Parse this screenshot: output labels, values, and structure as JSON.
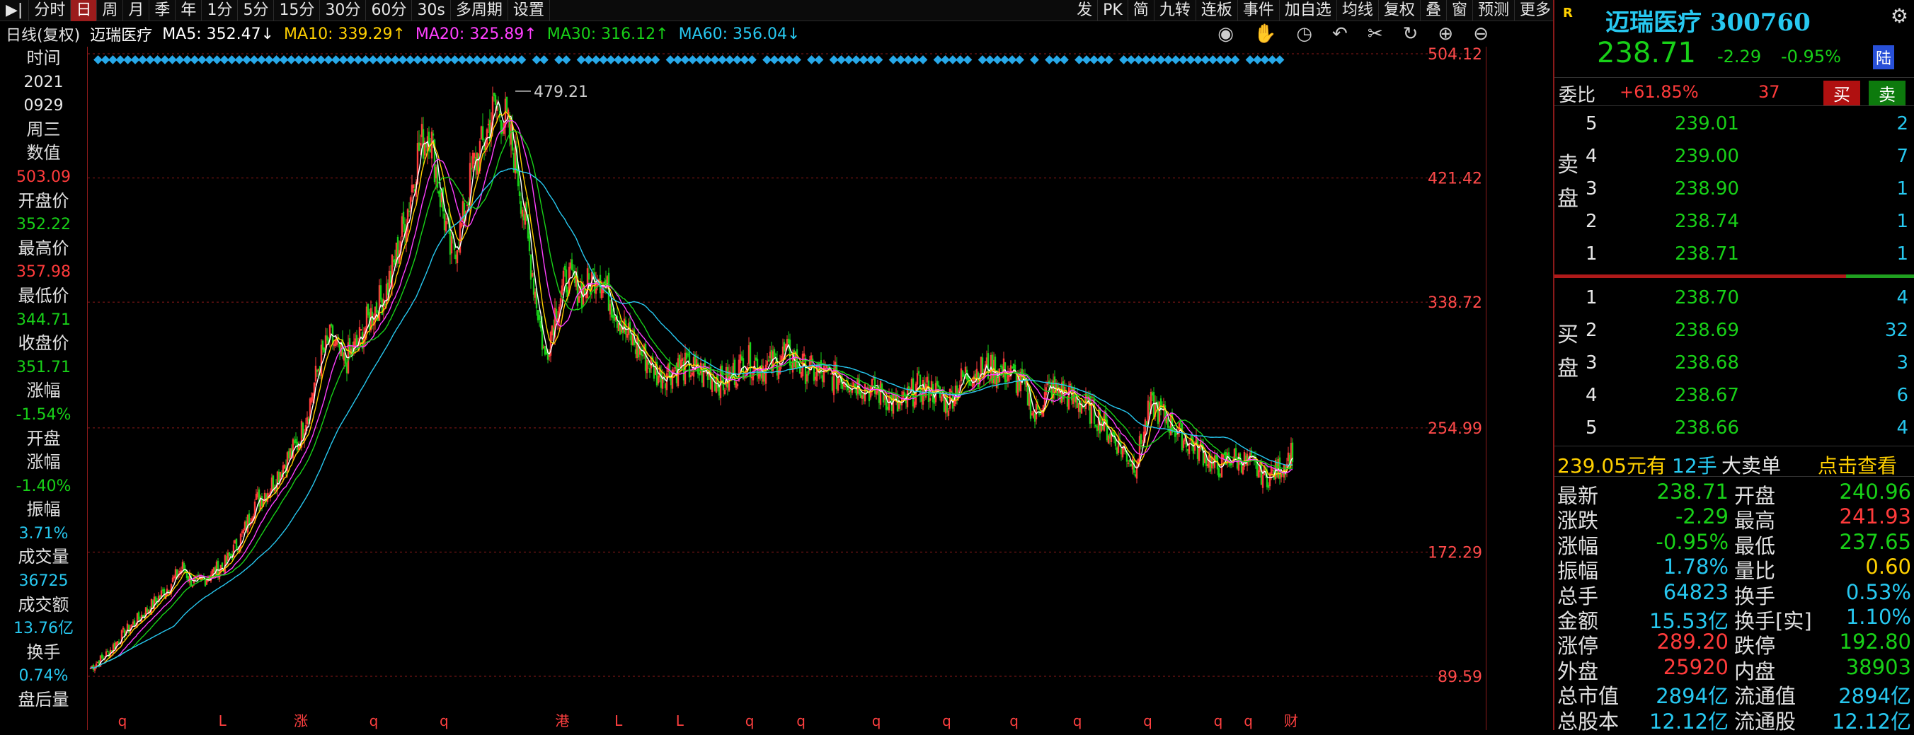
{
  "toolbar": {
    "items": [
      "分时",
      "日",
      "周",
      "月",
      "季",
      "年",
      "1分",
      "5分",
      "15分",
      "30分",
      "60分",
      "30s",
      "多周期",
      "设置"
    ],
    "active_index": 1,
    "right_items": [
      "发",
      "PK",
      "简",
      "九转",
      "连板",
      "事件",
      "加自选",
      "均线",
      "复权",
      "叠",
      "窗",
      "预测",
      "更多"
    ]
  },
  "chart_header": {
    "period": "日线(复权)",
    "name": "迈瑞医疗",
    "ma5": "MA5: 352.47↓",
    "ma10": "MA10: 339.29↑",
    "ma20": "MA20: 325.89↑",
    "ma30": "MA30: 316.12↑",
    "ma60": "MA60: 356.04↓"
  },
  "left_panel": [
    {
      "label": "时间"
    },
    {
      "value": "2021",
      "color": "white"
    },
    {
      "value": "0929",
      "color": "white"
    },
    {
      "label": "周三"
    },
    {
      "label": "数值"
    },
    {
      "value": "503.09",
      "color": "red"
    },
    {
      "label": "开盘价"
    },
    {
      "value": "352.22",
      "color": "green"
    },
    {
      "label": "最高价"
    },
    {
      "value": "357.98",
      "color": "red"
    },
    {
      "label": "最低价"
    },
    {
      "value": "344.71",
      "color": "green"
    },
    {
      "label": "收盘价"
    },
    {
      "value": "351.71",
      "color": "green"
    },
    {
      "label": "涨幅"
    },
    {
      "value": "-1.54%",
      "color": "green"
    },
    {
      "label": "开盘"
    },
    {
      "label": "涨幅"
    },
    {
      "value": "-1.40%",
      "color": "green"
    },
    {
      "label": "振幅"
    },
    {
      "value": "3.71%",
      "color": "cyan"
    },
    {
      "label": "成交量"
    },
    {
      "value": "36725",
      "color": "cyan"
    },
    {
      "label": "成交额"
    },
    {
      "value": "13.76亿",
      "color": "cyan"
    },
    {
      "label": "换手"
    },
    {
      "value": "0.74%",
      "color": "cyan"
    },
    {
      "label": "盘后量"
    }
  ],
  "chart_data": {
    "type": "candlestick",
    "ylim": [
      89.59,
      504.12
    ],
    "y_ticks": [
      "504.12",
      "421.42",
      "338.72",
      "254.99",
      "172.29",
      "89.59"
    ],
    "y_tick_values": [
      504.12,
      421.42,
      338.72,
      254.99,
      172.29,
      89.59
    ],
    "high_marker": "479.21",
    "high_marker_value": 479.21,
    "price_path": [
      [
        0,
        95
      ],
      [
        8,
        105
      ],
      [
        15,
        118
      ],
      [
        22,
        128
      ],
      [
        30,
        140
      ],
      [
        36,
        150
      ],
      [
        42,
        162
      ],
      [
        48,
        150
      ],
      [
        55,
        158
      ],
      [
        62,
        165
      ],
      [
        70,
        185
      ],
      [
        75,
        205
      ],
      [
        82,
        215
      ],
      [
        88,
        230
      ],
      [
        95,
        245
      ],
      [
        100,
        270
      ],
      [
        105,
        300
      ],
      [
        110,
        315
      ],
      [
        116,
        298
      ],
      [
        122,
        310
      ],
      [
        128,
        330
      ],
      [
        135,
        345
      ],
      [
        140,
        370
      ],
      [
        145,
        400
      ],
      [
        150,
        440
      ],
      [
        155,
        455
      ],
      [
        160,
        410
      ],
      [
        165,
        370
      ],
      [
        170,
        390
      ],
      [
        175,
        430
      ],
      [
        180,
        445
      ],
      [
        185,
        470
      ],
      [
        190,
        460
      ],
      [
        195,
        430
      ],
      [
        200,
        380
      ],
      [
        205,
        330
      ],
      [
        208,
        300
      ],
      [
        212,
        330
      ],
      [
        218,
        355
      ],
      [
        225,
        345
      ],
      [
        232,
        360
      ],
      [
        238,
        340
      ],
      [
        245,
        318
      ],
      [
        252,
        305
      ],
      [
        260,
        290
      ],
      [
        270,
        296
      ],
      [
        280,
        292
      ],
      [
        290,
        285
      ],
      [
        300,
        300
      ],
      [
        310,
        295
      ],
      [
        318,
        305
      ],
      [
        325,
        296
      ],
      [
        335,
        290
      ],
      [
        345,
        288
      ],
      [
        355,
        282
      ],
      [
        362,
        278
      ],
      [
        370,
        268
      ],
      [
        378,
        282
      ],
      [
        385,
        280
      ],
      [
        392,
        272
      ],
      [
        400,
        290
      ],
      [
        410,
        294
      ],
      [
        420,
        292
      ],
      [
        428,
        280
      ],
      [
        432,
        262
      ],
      [
        438,
        280
      ],
      [
        446,
        278
      ],
      [
        455,
        270
      ],
      [
        462,
        260
      ],
      [
        470,
        245
      ],
      [
        478,
        230
      ],
      [
        485,
        270
      ],
      [
        492,
        262
      ],
      [
        500,
        248
      ],
      [
        508,
        240
      ],
      [
        515,
        228
      ],
      [
        522,
        235
      ],
      [
        530,
        232
      ],
      [
        538,
        222
      ],
      [
        546,
        230
      ],
      [
        550,
        240
      ]
    ],
    "bottom_markers": [
      "q",
      "L",
      "涨",
      "q",
      "q",
      "港",
      "L",
      "L",
      "q",
      "q",
      "q",
      "q",
      "q",
      "q",
      "q",
      "q",
      "q",
      "财"
    ],
    "ma_colors": {
      "ma5": "#ffffff",
      "ma10": "#ffd000",
      "ma20": "#ff40ff",
      "ma30": "#18d018",
      "ma60": "#27c8f0"
    }
  },
  "quote": {
    "title": "迈瑞医疗 300760",
    "price": "238.71",
    "change": "-2.29",
    "change_pct": "-0.95%",
    "market_badge": "陆",
    "weibi_label": "委比",
    "weibi": "+61.85%",
    "weicha": "37",
    "buy_btn": "买",
    "sell_btn": "卖",
    "sell_side_label": "卖盘",
    "buy_side_label": "买盘",
    "asks": [
      {
        "lvl": "5",
        "price": "239.01",
        "vol": "2"
      },
      {
        "lvl": "4",
        "price": "239.00",
        "vol": "7"
      },
      {
        "lvl": "3",
        "price": "238.90",
        "vol": "1"
      },
      {
        "lvl": "2",
        "price": "238.74",
        "vol": "1"
      },
      {
        "lvl": "1",
        "price": "238.71",
        "vol": "1"
      }
    ],
    "bids": [
      {
        "lvl": "1",
        "price": "238.70",
        "vol": "4"
      },
      {
        "lvl": "2",
        "price": "238.69",
        "vol": "32"
      },
      {
        "lvl": "3",
        "price": "238.68",
        "vol": "3"
      },
      {
        "lvl": "4",
        "price": "238.67",
        "vol": "6"
      },
      {
        "lvl": "5",
        "price": "238.66",
        "vol": "4"
      }
    ],
    "big_order_price": "239.05元有",
    "big_order_qty": "12手",
    "big_order_type": "大卖单",
    "big_order_link": "点击查看",
    "stats": [
      {
        "l1": "最新",
        "v1": "238.71",
        "c1": "green",
        "l2": "开盘",
        "v2": "240.96",
        "c2": "green"
      },
      {
        "l1": "涨跌",
        "v1": "-2.29",
        "c1": "green",
        "l2": "最高",
        "v2": "241.93",
        "c2": "red"
      },
      {
        "l1": "涨幅",
        "v1": "-0.95%",
        "c1": "green",
        "l2": "最低",
        "v2": "237.65",
        "c2": "green"
      },
      {
        "l1": "振幅",
        "v1": "1.78%",
        "c1": "cyan",
        "l2": "量比",
        "v2": "0.60",
        "c2": "yellow"
      },
      {
        "l1": "总手",
        "v1": "64823",
        "c1": "cyan",
        "l2": "换手",
        "v2": "0.53%",
        "c2": "cyan"
      },
      {
        "l1": "金额",
        "v1": "15.53亿",
        "c1": "cyan",
        "l2": "换手[实]",
        "v2": "1.10%",
        "c2": "cyan"
      },
      {
        "l1": "涨停",
        "v1": "289.20",
        "c1": "red",
        "l2": "跌停",
        "v2": "192.80",
        "c2": "green"
      },
      {
        "l1": "外盘",
        "v1": "25920",
        "c1": "red",
        "l2": "内盘",
        "v2": "38903",
        "c2": "green"
      },
      {
        "l1": "总市值",
        "v1": "2894亿",
        "c1": "cyan",
        "l2": "流通值",
        "v2": "2894亿",
        "c2": "cyan"
      },
      {
        "l1": "总股本",
        "v1": "12.12亿",
        "c1": "cyan",
        "l2": "流通股",
        "v2": "12.12亿",
        "c2": "cyan"
      }
    ]
  },
  "colors": {
    "up": "#ff3b3b",
    "down": "#18d018",
    "grid": "#8b1a1a",
    "accent": "#27c8f0"
  }
}
